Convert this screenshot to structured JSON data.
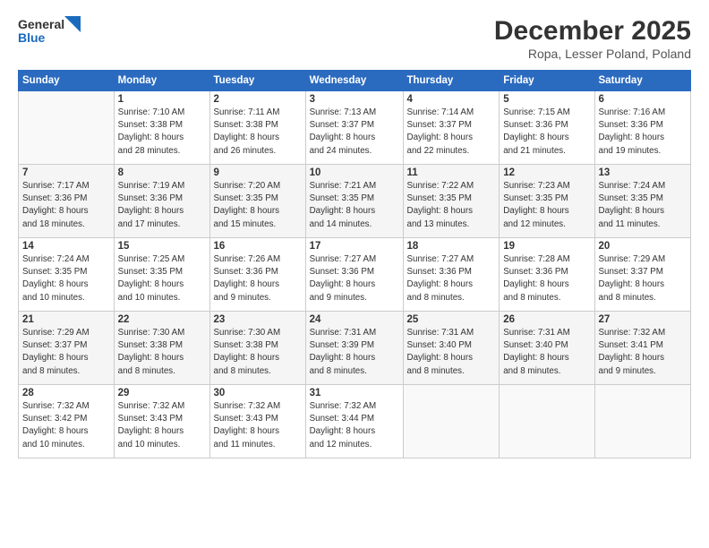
{
  "logo": {
    "line1": "General",
    "line2": "Blue"
  },
  "title": "December 2025",
  "location": "Ropa, Lesser Poland, Poland",
  "days_of_week": [
    "Sunday",
    "Monday",
    "Tuesday",
    "Wednesday",
    "Thursday",
    "Friday",
    "Saturday"
  ],
  "weeks": [
    [
      {
        "day": "",
        "info": ""
      },
      {
        "day": "1",
        "info": "Sunrise: 7:10 AM\nSunset: 3:38 PM\nDaylight: 8 hours\nand 28 minutes."
      },
      {
        "day": "2",
        "info": "Sunrise: 7:11 AM\nSunset: 3:38 PM\nDaylight: 8 hours\nand 26 minutes."
      },
      {
        "day": "3",
        "info": "Sunrise: 7:13 AM\nSunset: 3:37 PM\nDaylight: 8 hours\nand 24 minutes."
      },
      {
        "day": "4",
        "info": "Sunrise: 7:14 AM\nSunset: 3:37 PM\nDaylight: 8 hours\nand 22 minutes."
      },
      {
        "day": "5",
        "info": "Sunrise: 7:15 AM\nSunset: 3:36 PM\nDaylight: 8 hours\nand 21 minutes."
      },
      {
        "day": "6",
        "info": "Sunrise: 7:16 AM\nSunset: 3:36 PM\nDaylight: 8 hours\nand 19 minutes."
      }
    ],
    [
      {
        "day": "7",
        "info": "Sunrise: 7:17 AM\nSunset: 3:36 PM\nDaylight: 8 hours\nand 18 minutes."
      },
      {
        "day": "8",
        "info": "Sunrise: 7:19 AM\nSunset: 3:36 PM\nDaylight: 8 hours\nand 17 minutes."
      },
      {
        "day": "9",
        "info": "Sunrise: 7:20 AM\nSunset: 3:35 PM\nDaylight: 8 hours\nand 15 minutes."
      },
      {
        "day": "10",
        "info": "Sunrise: 7:21 AM\nSunset: 3:35 PM\nDaylight: 8 hours\nand 14 minutes."
      },
      {
        "day": "11",
        "info": "Sunrise: 7:22 AM\nSunset: 3:35 PM\nDaylight: 8 hours\nand 13 minutes."
      },
      {
        "day": "12",
        "info": "Sunrise: 7:23 AM\nSunset: 3:35 PM\nDaylight: 8 hours\nand 12 minutes."
      },
      {
        "day": "13",
        "info": "Sunrise: 7:24 AM\nSunset: 3:35 PM\nDaylight: 8 hours\nand 11 minutes."
      }
    ],
    [
      {
        "day": "14",
        "info": "Sunrise: 7:24 AM\nSunset: 3:35 PM\nDaylight: 8 hours\nand 10 minutes."
      },
      {
        "day": "15",
        "info": "Sunrise: 7:25 AM\nSunset: 3:35 PM\nDaylight: 8 hours\nand 10 minutes."
      },
      {
        "day": "16",
        "info": "Sunrise: 7:26 AM\nSunset: 3:36 PM\nDaylight: 8 hours\nand 9 minutes."
      },
      {
        "day": "17",
        "info": "Sunrise: 7:27 AM\nSunset: 3:36 PM\nDaylight: 8 hours\nand 9 minutes."
      },
      {
        "day": "18",
        "info": "Sunrise: 7:27 AM\nSunset: 3:36 PM\nDaylight: 8 hours\nand 8 minutes."
      },
      {
        "day": "19",
        "info": "Sunrise: 7:28 AM\nSunset: 3:36 PM\nDaylight: 8 hours\nand 8 minutes."
      },
      {
        "day": "20",
        "info": "Sunrise: 7:29 AM\nSunset: 3:37 PM\nDaylight: 8 hours\nand 8 minutes."
      }
    ],
    [
      {
        "day": "21",
        "info": "Sunrise: 7:29 AM\nSunset: 3:37 PM\nDaylight: 8 hours\nand 8 minutes."
      },
      {
        "day": "22",
        "info": "Sunrise: 7:30 AM\nSunset: 3:38 PM\nDaylight: 8 hours\nand 8 minutes."
      },
      {
        "day": "23",
        "info": "Sunrise: 7:30 AM\nSunset: 3:38 PM\nDaylight: 8 hours\nand 8 minutes."
      },
      {
        "day": "24",
        "info": "Sunrise: 7:31 AM\nSunset: 3:39 PM\nDaylight: 8 hours\nand 8 minutes."
      },
      {
        "day": "25",
        "info": "Sunrise: 7:31 AM\nSunset: 3:40 PM\nDaylight: 8 hours\nand 8 minutes."
      },
      {
        "day": "26",
        "info": "Sunrise: 7:31 AM\nSunset: 3:40 PM\nDaylight: 8 hours\nand 8 minutes."
      },
      {
        "day": "27",
        "info": "Sunrise: 7:32 AM\nSunset: 3:41 PM\nDaylight: 8 hours\nand 9 minutes."
      }
    ],
    [
      {
        "day": "28",
        "info": "Sunrise: 7:32 AM\nSunset: 3:42 PM\nDaylight: 8 hours\nand 10 minutes."
      },
      {
        "day": "29",
        "info": "Sunrise: 7:32 AM\nSunset: 3:43 PM\nDaylight: 8 hours\nand 10 minutes."
      },
      {
        "day": "30",
        "info": "Sunrise: 7:32 AM\nSunset: 3:43 PM\nDaylight: 8 hours\nand 11 minutes."
      },
      {
        "day": "31",
        "info": "Sunrise: 7:32 AM\nSunset: 3:44 PM\nDaylight: 8 hours\nand 12 minutes."
      },
      {
        "day": "",
        "info": ""
      },
      {
        "day": "",
        "info": ""
      },
      {
        "day": "",
        "info": ""
      }
    ]
  ]
}
